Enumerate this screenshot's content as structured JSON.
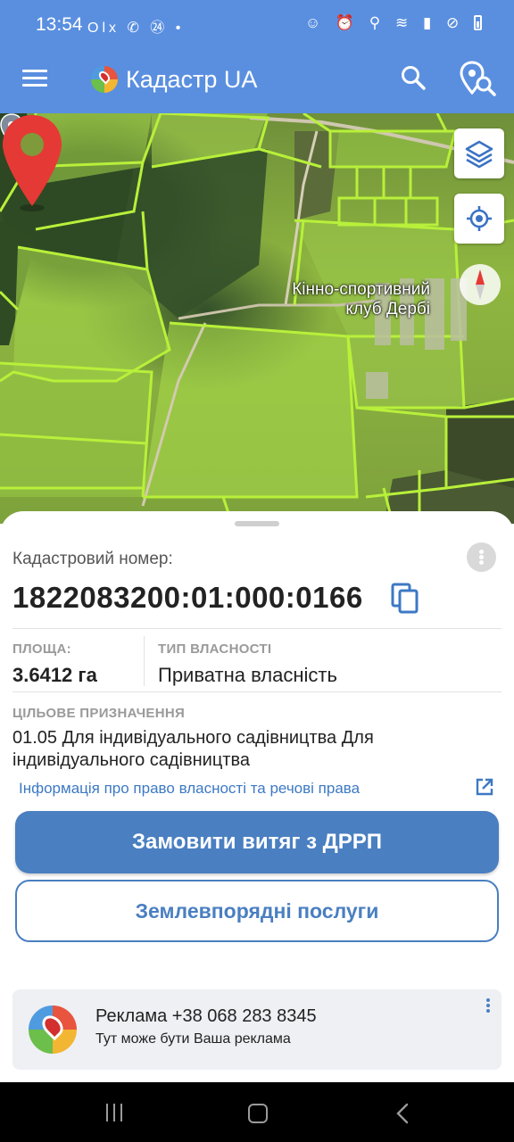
{
  "status_bar": {
    "time": "13:54",
    "left_icons": "Olx ✆ ㉔ •",
    "right_icons": "☺ ⏰ ⚲ ≋ ▮ ⊘"
  },
  "app_bar": {
    "title": "Кадастр UA",
    "background": "#5a8fe0"
  },
  "map": {
    "poi_label": "Кінно-спортивний клуб Дербі",
    "pin_color": "#e53935",
    "parcel_outline_color": "#b8f03a"
  },
  "parcel": {
    "cadastral_label": "Кадастровий номер:",
    "cadastral_number": "1822083200:01:000:0166",
    "area_caption": "ПЛОЩА:",
    "area_value": "3.6412 га",
    "ownership_caption": "ТИП ВЛАСНОСТІ",
    "ownership_value": "Приватна власність",
    "purpose_caption": "ЦІЛЬОВЕ ПРИЗНАЧЕННЯ",
    "purpose_value": "01.05 Для індивідуального садівництва Для індивідуального садівництва",
    "rights_link": "Інформація про право власності та речові права"
  },
  "actions": {
    "primary": "Замовити витяг з ДРРП",
    "secondary": "Землевпорядні послуги",
    "accent": "#4a7fc1"
  },
  "ad": {
    "title": "Реклама   +38 068 283 8345",
    "subtitle": "Тут може бути Ваша реклама"
  }
}
